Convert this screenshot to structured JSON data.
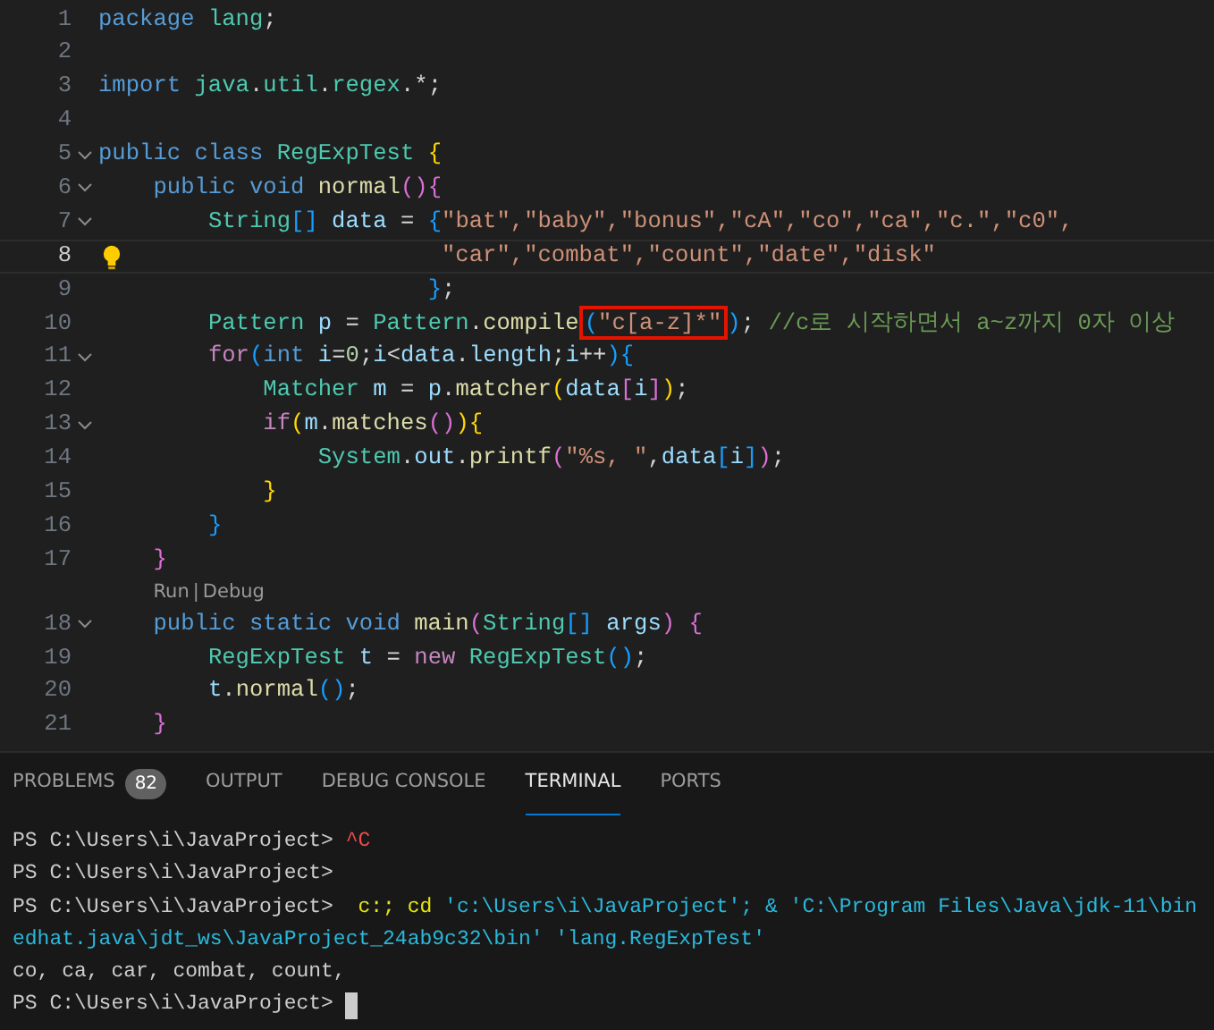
{
  "editor": {
    "lines": [
      {
        "kind": "code",
        "number": "1",
        "tokens": [
          {
            "kind": "kw",
            "text": "package"
          },
          {
            "kind": "type",
            "text": " lang"
          },
          {
            "kind": "plain",
            "text": ";"
          }
        ]
      },
      {
        "kind": "code",
        "number": "2"
      },
      {
        "kind": "code",
        "number": "3",
        "tokens": [
          {
            "kind": "kw",
            "text": "import"
          },
          {
            "kind": "type",
            "text": " java"
          },
          {
            "kind": "plain",
            "text": "."
          },
          {
            "kind": "type",
            "text": "util"
          },
          {
            "kind": "plain",
            "text": "."
          },
          {
            "kind": "type",
            "text": "regex"
          },
          {
            "kind": "plain",
            "text": ".*;"
          }
        ]
      },
      {
        "kind": "code",
        "number": "4"
      },
      {
        "kind": "code",
        "number": "5",
        "foldable": true,
        "tokens": [
          {
            "kind": "kw",
            "text": "public class"
          },
          {
            "kind": "type",
            "text": " RegExpTest"
          },
          {
            "kind": "b1",
            "text": " {"
          }
        ]
      },
      {
        "kind": "code",
        "number": "6",
        "foldable": true,
        "tokens": [
          {
            "kind": "kw",
            "text": "    public void"
          },
          {
            "kind": "fn",
            "text": " normal"
          },
          {
            "kind": "b2",
            "text": "(){"
          }
        ]
      },
      {
        "kind": "code",
        "number": "7",
        "foldable": true,
        "tokens": [
          {
            "kind": "type",
            "text": "        String"
          },
          {
            "kind": "b3",
            "text": "[]"
          },
          {
            "kind": "var",
            "text": " data"
          },
          {
            "kind": "plain",
            "text": " = "
          },
          {
            "kind": "b3",
            "text": "{"
          },
          {
            "kind": "str",
            "text": "\"bat\",\"baby\",\"bonus\",\"cA\",\"co\",\"ca\",\"c.\",\"c0\","
          }
        ]
      },
      {
        "kind": "code",
        "number": "8",
        "selected": true,
        "lightbulb": true,
        "tokens": [
          {
            "kind": "str",
            "text": "                         \"car\",\"combat\",\"count\",\"date\",\"disk\""
          }
        ]
      },
      {
        "kind": "code",
        "number": "9",
        "tokens": [
          {
            "kind": "b3",
            "text": "                        }"
          },
          {
            "kind": "plain",
            "text": ";"
          }
        ]
      },
      {
        "kind": "code",
        "number": "10",
        "tokens": [
          {
            "kind": "type",
            "text": "        Pattern"
          },
          {
            "kind": "var",
            "text": " p"
          },
          {
            "kind": "plain",
            "text": " = "
          },
          {
            "kind": "type",
            "text": "Pattern"
          },
          {
            "kind": "plain",
            "text": "."
          },
          {
            "kind": "fn",
            "text": "compile"
          },
          {
            "kind": "boxed",
            "tokens": [
              {
                "kind": "b3",
                "text": "("
              },
              {
                "kind": "str",
                "text": "\"c[a-z]*\""
              }
            ]
          },
          {
            "kind": "b3",
            "text": ")"
          },
          {
            "kind": "plain",
            "text": ";"
          },
          {
            "kind": "cmt",
            "text": " //c로 시작하면서 a~z까지 0자 이상"
          }
        ]
      },
      {
        "kind": "code",
        "number": "11",
        "foldable": true,
        "tokens": [
          {
            "kind": "ctrl",
            "text": "        for"
          },
          {
            "kind": "b3",
            "text": "("
          },
          {
            "kind": "kw",
            "text": "int"
          },
          {
            "kind": "var",
            "text": " i"
          },
          {
            "kind": "plain",
            "text": "="
          },
          {
            "kind": "num",
            "text": "0"
          },
          {
            "kind": "plain",
            "text": ";"
          },
          {
            "kind": "var",
            "text": "i"
          },
          {
            "kind": "plain",
            "text": "<"
          },
          {
            "kind": "var",
            "text": "data"
          },
          {
            "kind": "plain",
            "text": "."
          },
          {
            "kind": "var",
            "text": "length"
          },
          {
            "kind": "plain",
            "text": ";"
          },
          {
            "kind": "var",
            "text": "i"
          },
          {
            "kind": "plain",
            "text": "++"
          },
          {
            "kind": "b3",
            "text": "){"
          }
        ]
      },
      {
        "kind": "code",
        "number": "12",
        "tokens": [
          {
            "kind": "type",
            "text": "            Matcher"
          },
          {
            "kind": "var",
            "text": " m"
          },
          {
            "kind": "plain",
            "text": " = "
          },
          {
            "kind": "var",
            "text": "p"
          },
          {
            "kind": "plain",
            "text": "."
          },
          {
            "kind": "fn",
            "text": "matcher"
          },
          {
            "kind": "b1",
            "text": "("
          },
          {
            "kind": "var",
            "text": "data"
          },
          {
            "kind": "b2",
            "text": "["
          },
          {
            "kind": "var",
            "text": "i"
          },
          {
            "kind": "b2",
            "text": "]"
          },
          {
            "kind": "b1",
            "text": ")"
          },
          {
            "kind": "plain",
            "text": ";"
          }
        ]
      },
      {
        "kind": "code",
        "number": "13",
        "foldable": true,
        "tokens": [
          {
            "kind": "ctrl",
            "text": "            if"
          },
          {
            "kind": "b1",
            "text": "("
          },
          {
            "kind": "var",
            "text": "m"
          },
          {
            "kind": "plain",
            "text": "."
          },
          {
            "kind": "fn",
            "text": "matches"
          },
          {
            "kind": "b2",
            "text": "()"
          },
          {
            "kind": "b1",
            "text": "){"
          }
        ]
      },
      {
        "kind": "code",
        "number": "14",
        "tokens": [
          {
            "kind": "type",
            "text": "                System"
          },
          {
            "kind": "plain",
            "text": "."
          },
          {
            "kind": "var",
            "text": "out"
          },
          {
            "kind": "plain",
            "text": "."
          },
          {
            "kind": "fn",
            "text": "printf"
          },
          {
            "kind": "b2",
            "text": "("
          },
          {
            "kind": "str",
            "text": "\"%s, \""
          },
          {
            "kind": "plain",
            "text": ","
          },
          {
            "kind": "var",
            "text": "data"
          },
          {
            "kind": "b3",
            "text": "["
          },
          {
            "kind": "var",
            "text": "i"
          },
          {
            "kind": "b3",
            "text": "]"
          },
          {
            "kind": "b2",
            "text": ")"
          },
          {
            "kind": "plain",
            "text": ";"
          }
        ]
      },
      {
        "kind": "code",
        "number": "15",
        "tokens": [
          {
            "kind": "b1",
            "text": "            }"
          }
        ]
      },
      {
        "kind": "code",
        "number": "16",
        "tokens": [
          {
            "kind": "b3",
            "text": "        }"
          }
        ]
      },
      {
        "kind": "code",
        "number": "17",
        "tokens": [
          {
            "kind": "b2",
            "text": "    }"
          }
        ]
      },
      {
        "kind": "codelens",
        "links": [
          "Run",
          "Debug"
        ],
        "separator": "|"
      },
      {
        "kind": "code",
        "number": "18",
        "foldable": true,
        "tokens": [
          {
            "kind": "kw",
            "text": "    public static void"
          },
          {
            "kind": "fn",
            "text": " main"
          },
          {
            "kind": "b2",
            "text": "("
          },
          {
            "kind": "type",
            "text": "String"
          },
          {
            "kind": "b3",
            "text": "[]"
          },
          {
            "kind": "var",
            "text": " args"
          },
          {
            "kind": "b2",
            "text": ") {"
          }
        ]
      },
      {
        "kind": "code",
        "number": "19",
        "tokens": [
          {
            "kind": "type",
            "text": "        RegExpTest"
          },
          {
            "kind": "var",
            "text": " t"
          },
          {
            "kind": "plain",
            "text": " = "
          },
          {
            "kind": "ctrl",
            "text": "new"
          },
          {
            "kind": "type",
            "text": " RegExpTest"
          },
          {
            "kind": "b3",
            "text": "()"
          },
          {
            "kind": "plain",
            "text": ";"
          }
        ]
      },
      {
        "kind": "code",
        "number": "20",
        "tokens": [
          {
            "kind": "var",
            "text": "        t"
          },
          {
            "kind": "plain",
            "text": "."
          },
          {
            "kind": "fn",
            "text": "normal"
          },
          {
            "kind": "b3",
            "text": "()"
          },
          {
            "kind": "plain",
            "text": ";"
          }
        ]
      },
      {
        "kind": "code",
        "number": "21",
        "tokens": [
          {
            "kind": "b2",
            "text": "    }"
          }
        ]
      }
    ]
  },
  "panel": {
    "tabs": [
      {
        "label": "PROBLEMS",
        "badge": "82",
        "selected": false
      },
      {
        "label": "OUTPUT",
        "selected": false
      },
      {
        "label": "DEBUG CONSOLE",
        "selected": false
      },
      {
        "label": "TERMINAL",
        "selected": true
      },
      {
        "label": "PORTS",
        "selected": false
      }
    ],
    "terminal": {
      "lines": [
        {
          "segments": [
            {
              "kind": "plain",
              "text": "PS C:\\Users\\i\\JavaProject> "
            },
            {
              "kind": "error",
              "text": "^C"
            }
          ]
        },
        {
          "segments": [
            {
              "kind": "plain",
              "text": "PS C:\\Users\\i\\JavaProject>"
            }
          ]
        },
        {
          "segments": [
            {
              "kind": "plain",
              "text": "PS C:\\Users\\i\\JavaProject>  "
            },
            {
              "kind": "command",
              "text": "c:; cd"
            },
            {
              "kind": "arg",
              "text": " 'c:\\Users\\i\\JavaProject'; & 'C:\\Program Files\\Java\\jdk-11\\bin"
            }
          ]
        },
        {
          "segments": [
            {
              "kind": "arg",
              "text": "edhat.java\\jdt_ws\\JavaProject_24ab9c32\\bin' 'lang.RegExpTest'"
            }
          ]
        },
        {
          "segments": [
            {
              "kind": "plain",
              "text": "co, ca, car, combat, count,"
            }
          ]
        },
        {
          "segments": [
            {
              "kind": "plain",
              "text": "PS C:\\Users\\i\\JavaProject> "
            }
          ],
          "cursor": true
        }
      ]
    }
  }
}
